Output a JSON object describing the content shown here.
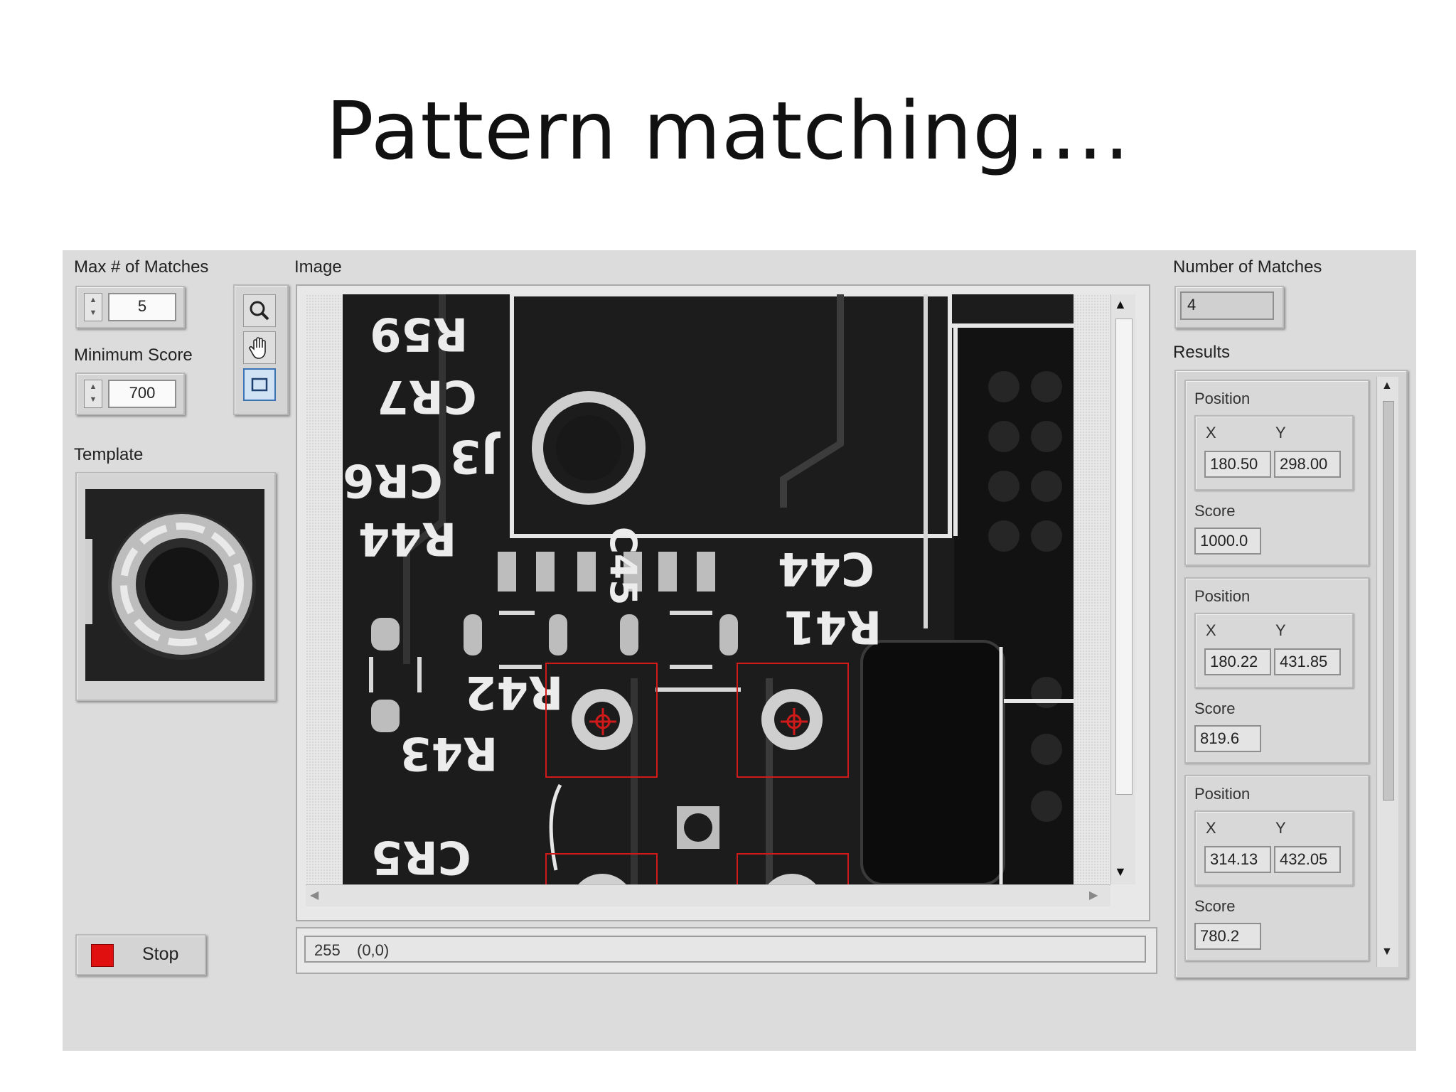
{
  "slide": {
    "title": "Pattern matching…."
  },
  "left": {
    "max_matches": {
      "label": "Max # of Matches",
      "value": "5"
    },
    "min_score": {
      "label": "Minimum Score",
      "value": "700"
    },
    "template": {
      "label": "Template"
    },
    "stop_button": {
      "label": "Stop"
    }
  },
  "tools": [
    "zoom-icon",
    "pan-hand-icon",
    "rectangle-select-icon"
  ],
  "image_panel": {
    "label": "Image",
    "status": {
      "value": "255",
      "coords": "(0,0)"
    },
    "silkscreen": [
      "R59",
      "CR7",
      "CR6",
      "J3",
      "R44",
      "C45",
      "C44",
      "R41",
      "R42",
      "R43",
      "CR5"
    ]
  },
  "right": {
    "num_matches": {
      "label": "Number of Matches",
      "value": "4"
    },
    "results_label": "Results",
    "results": [
      {
        "position_label": "Position",
        "x_label": "X",
        "y_label": "Y",
        "x": "180.50",
        "y": "298.00",
        "score_label": "Score",
        "score": "1000.0"
      },
      {
        "position_label": "Position",
        "x_label": "X",
        "y_label": "Y",
        "x": "180.22",
        "y": "431.85",
        "score_label": "Score",
        "score": "819.6"
      },
      {
        "position_label": "Position",
        "x_label": "X",
        "y_label": "Y",
        "x": "314.13",
        "y": "432.05",
        "score_label": "Score",
        "score": "780.2"
      }
    ]
  },
  "colors": {
    "match_outline": "#d01a1a",
    "stop_indicator": "#e01010",
    "panel_bg": "#dcdcdc"
  }
}
